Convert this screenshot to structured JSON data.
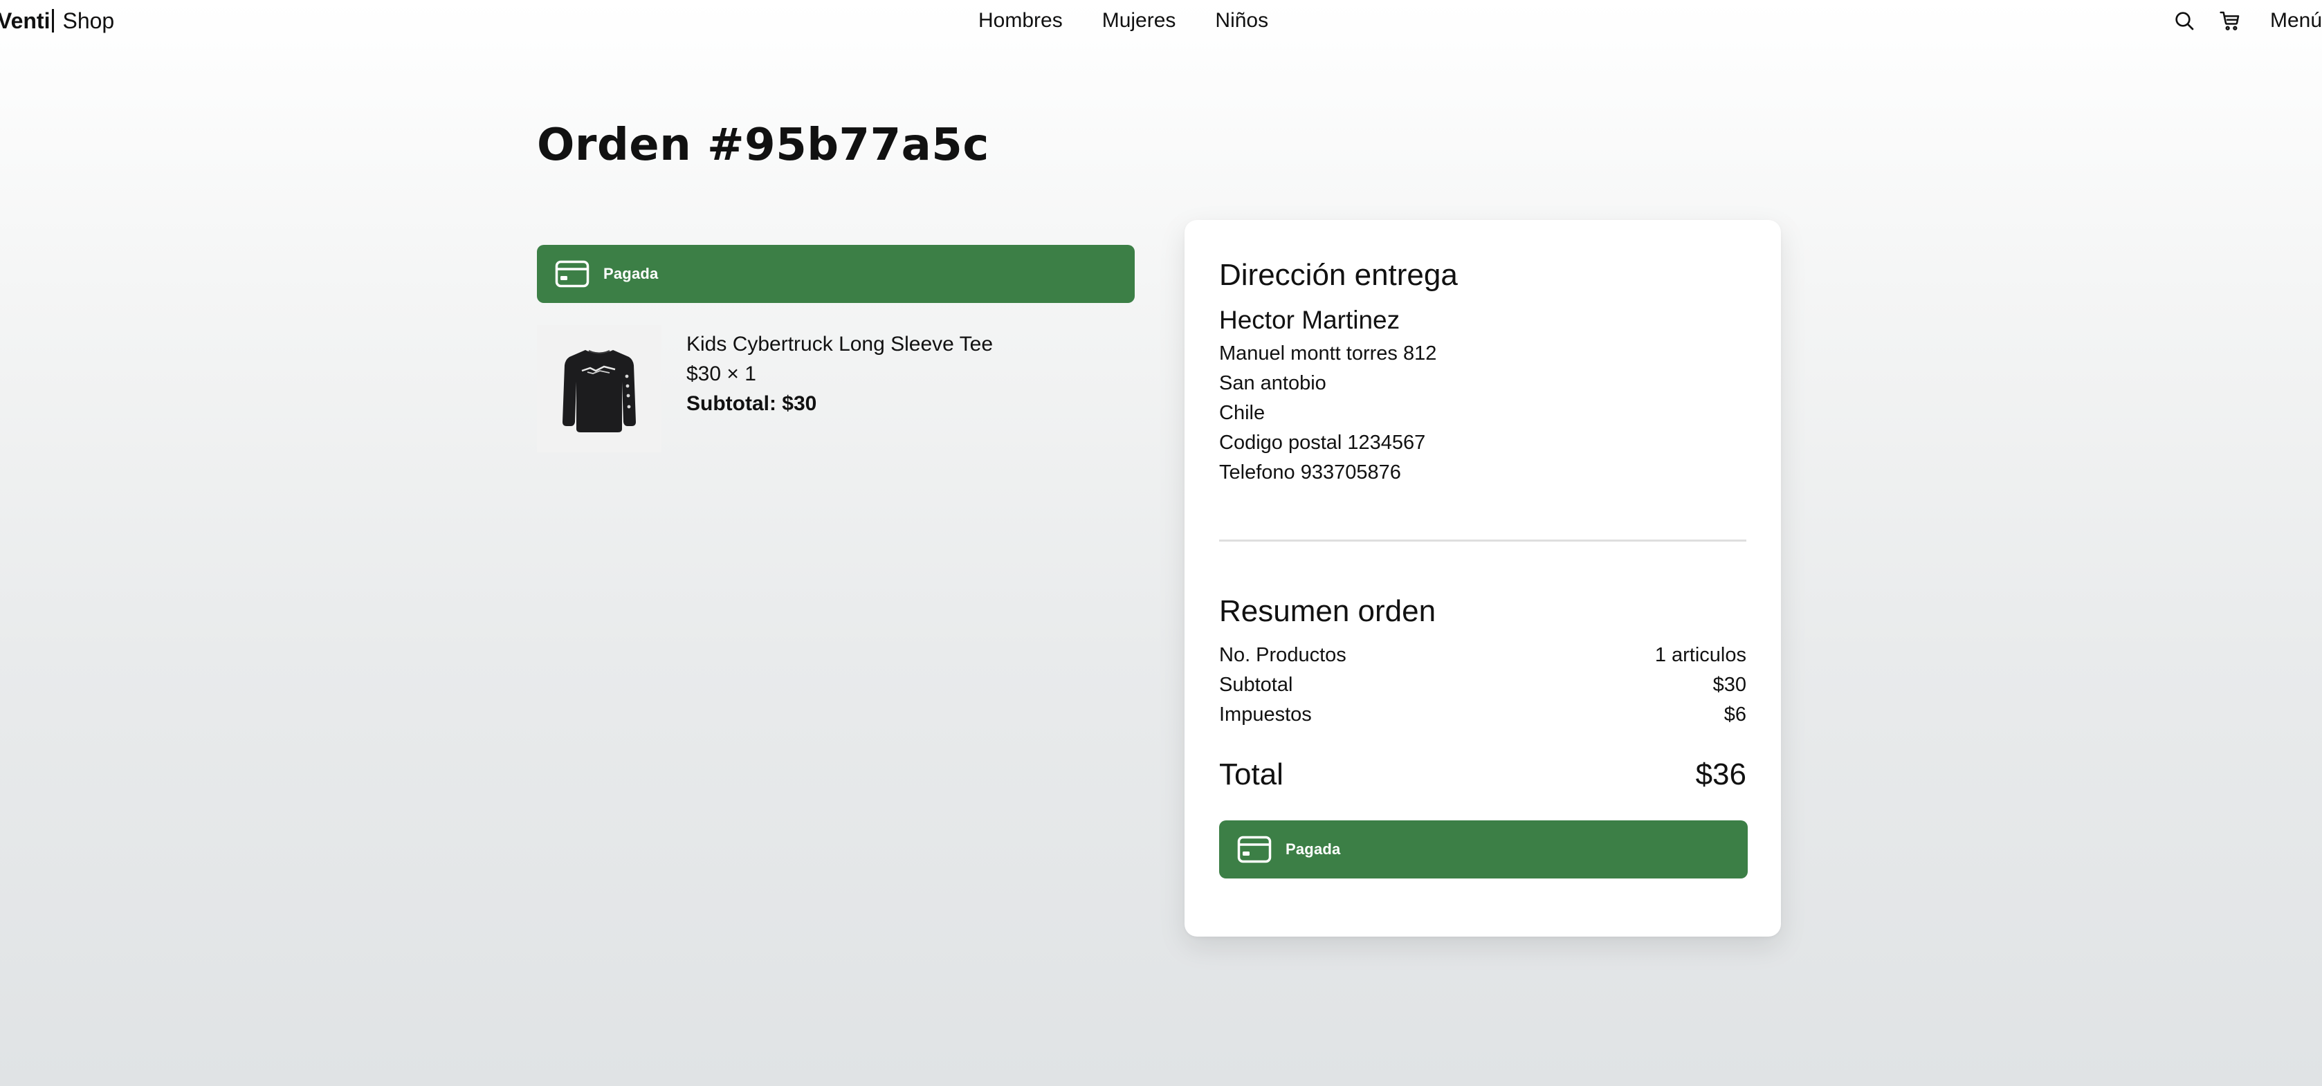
{
  "nav": {
    "brand_name": "Venti",
    "brand_suffix": "Shop",
    "links": [
      "Hombres",
      "Mujeres",
      "Niños"
    ],
    "search_icon": "search-icon",
    "cart_icon": "cart-icon",
    "menu_label": "Menú"
  },
  "order": {
    "title": "Orden #95b77a5c",
    "status_label": "Pagada",
    "status_icon": "credit-card-icon",
    "status_color": "#3c7f46",
    "item": {
      "name": "Kids Cybertruck Long Sleeve Tee",
      "price_qty": "$30 × 1",
      "subtotal": "Subtotal: $30",
      "image": "black-long-sleeve-tee-image"
    }
  },
  "delivery": {
    "heading": "Dirección entrega",
    "name": "Hector Martinez",
    "street": "Manuel montt torres 812",
    "city": "San antobio",
    "country": "Chile",
    "postal": "Codigo postal 1234567",
    "phone": "Telefono 933705876"
  },
  "summary": {
    "heading": "Resumen orden",
    "rows": [
      {
        "label": "No. Productos",
        "value": "1 articulos"
      },
      {
        "label": "Subtotal",
        "value": "$30"
      },
      {
        "label": "Impuestos",
        "value": "$6"
      }
    ],
    "total_label": "Total",
    "total_value": "$36",
    "status_label": "Pagada"
  }
}
